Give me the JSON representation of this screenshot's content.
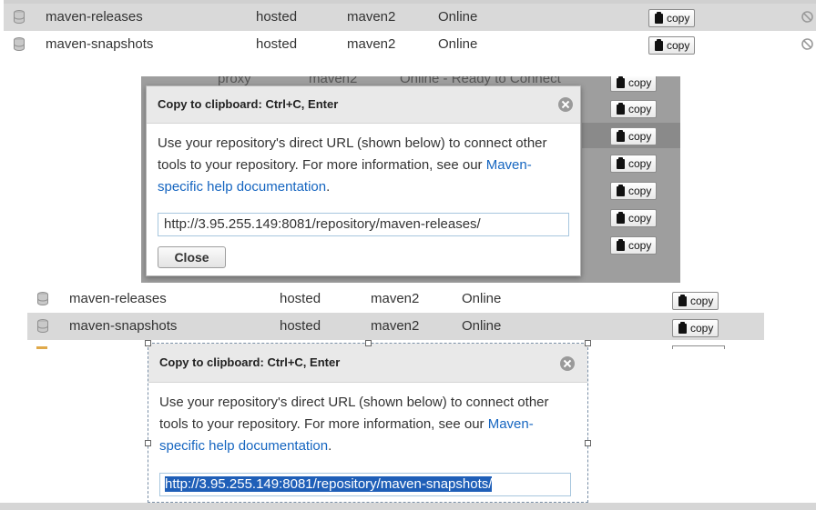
{
  "top_table": {
    "rows": [
      {
        "name": "maven-releases",
        "type": "hosted",
        "format": "maven2",
        "status": "Online",
        "copy": "copy"
      },
      {
        "name": "maven-snapshots",
        "type": "hosted",
        "format": "maven2",
        "status": "Online",
        "copy": "copy"
      }
    ]
  },
  "bg_table": {
    "partial_row": {
      "type": "proxy",
      "format": "maven2",
      "status": "Online - Ready to Connect"
    },
    "copy_label": "copy"
  },
  "modal1": {
    "title": "Copy to clipboard: Ctrl+C, Enter",
    "text_line1": "Use your repository's direct URL (shown below) to connect other",
    "text_line2a": "tools to your repository. For more information, see our ",
    "link_part1": "Maven-",
    "link_part2": "specific help documentation",
    "text_end": ".",
    "url": "http://3.95.255.149:8081/repository/maven-releases/",
    "close_label": "Close"
  },
  "mid_table": {
    "rows": [
      {
        "name": "maven-releases",
        "type": "hosted",
        "format": "maven2",
        "status": "Online",
        "copy": "copy"
      },
      {
        "name": "maven-snapshots",
        "type": "hosted",
        "format": "maven2",
        "status": "Online",
        "copy": "copy"
      }
    ]
  },
  "modal2": {
    "title": "Copy to clipboard: Ctrl+C, Enter",
    "text_line1": "Use your repository's direct URL (shown below) to connect other",
    "text_line2a": "tools to your repository. For more information, see our ",
    "link_part1": "Maven-",
    "link_part2": "specific help documentation",
    "text_end": ".",
    "url": "http://3.95.255.149:8081/repository/maven-snapshots/"
  },
  "colors": {
    "row_highlight": "#d9d9d9",
    "link": "#1565c0",
    "selection": "#1f5fb8",
    "overlay": "#9e9e9e"
  }
}
